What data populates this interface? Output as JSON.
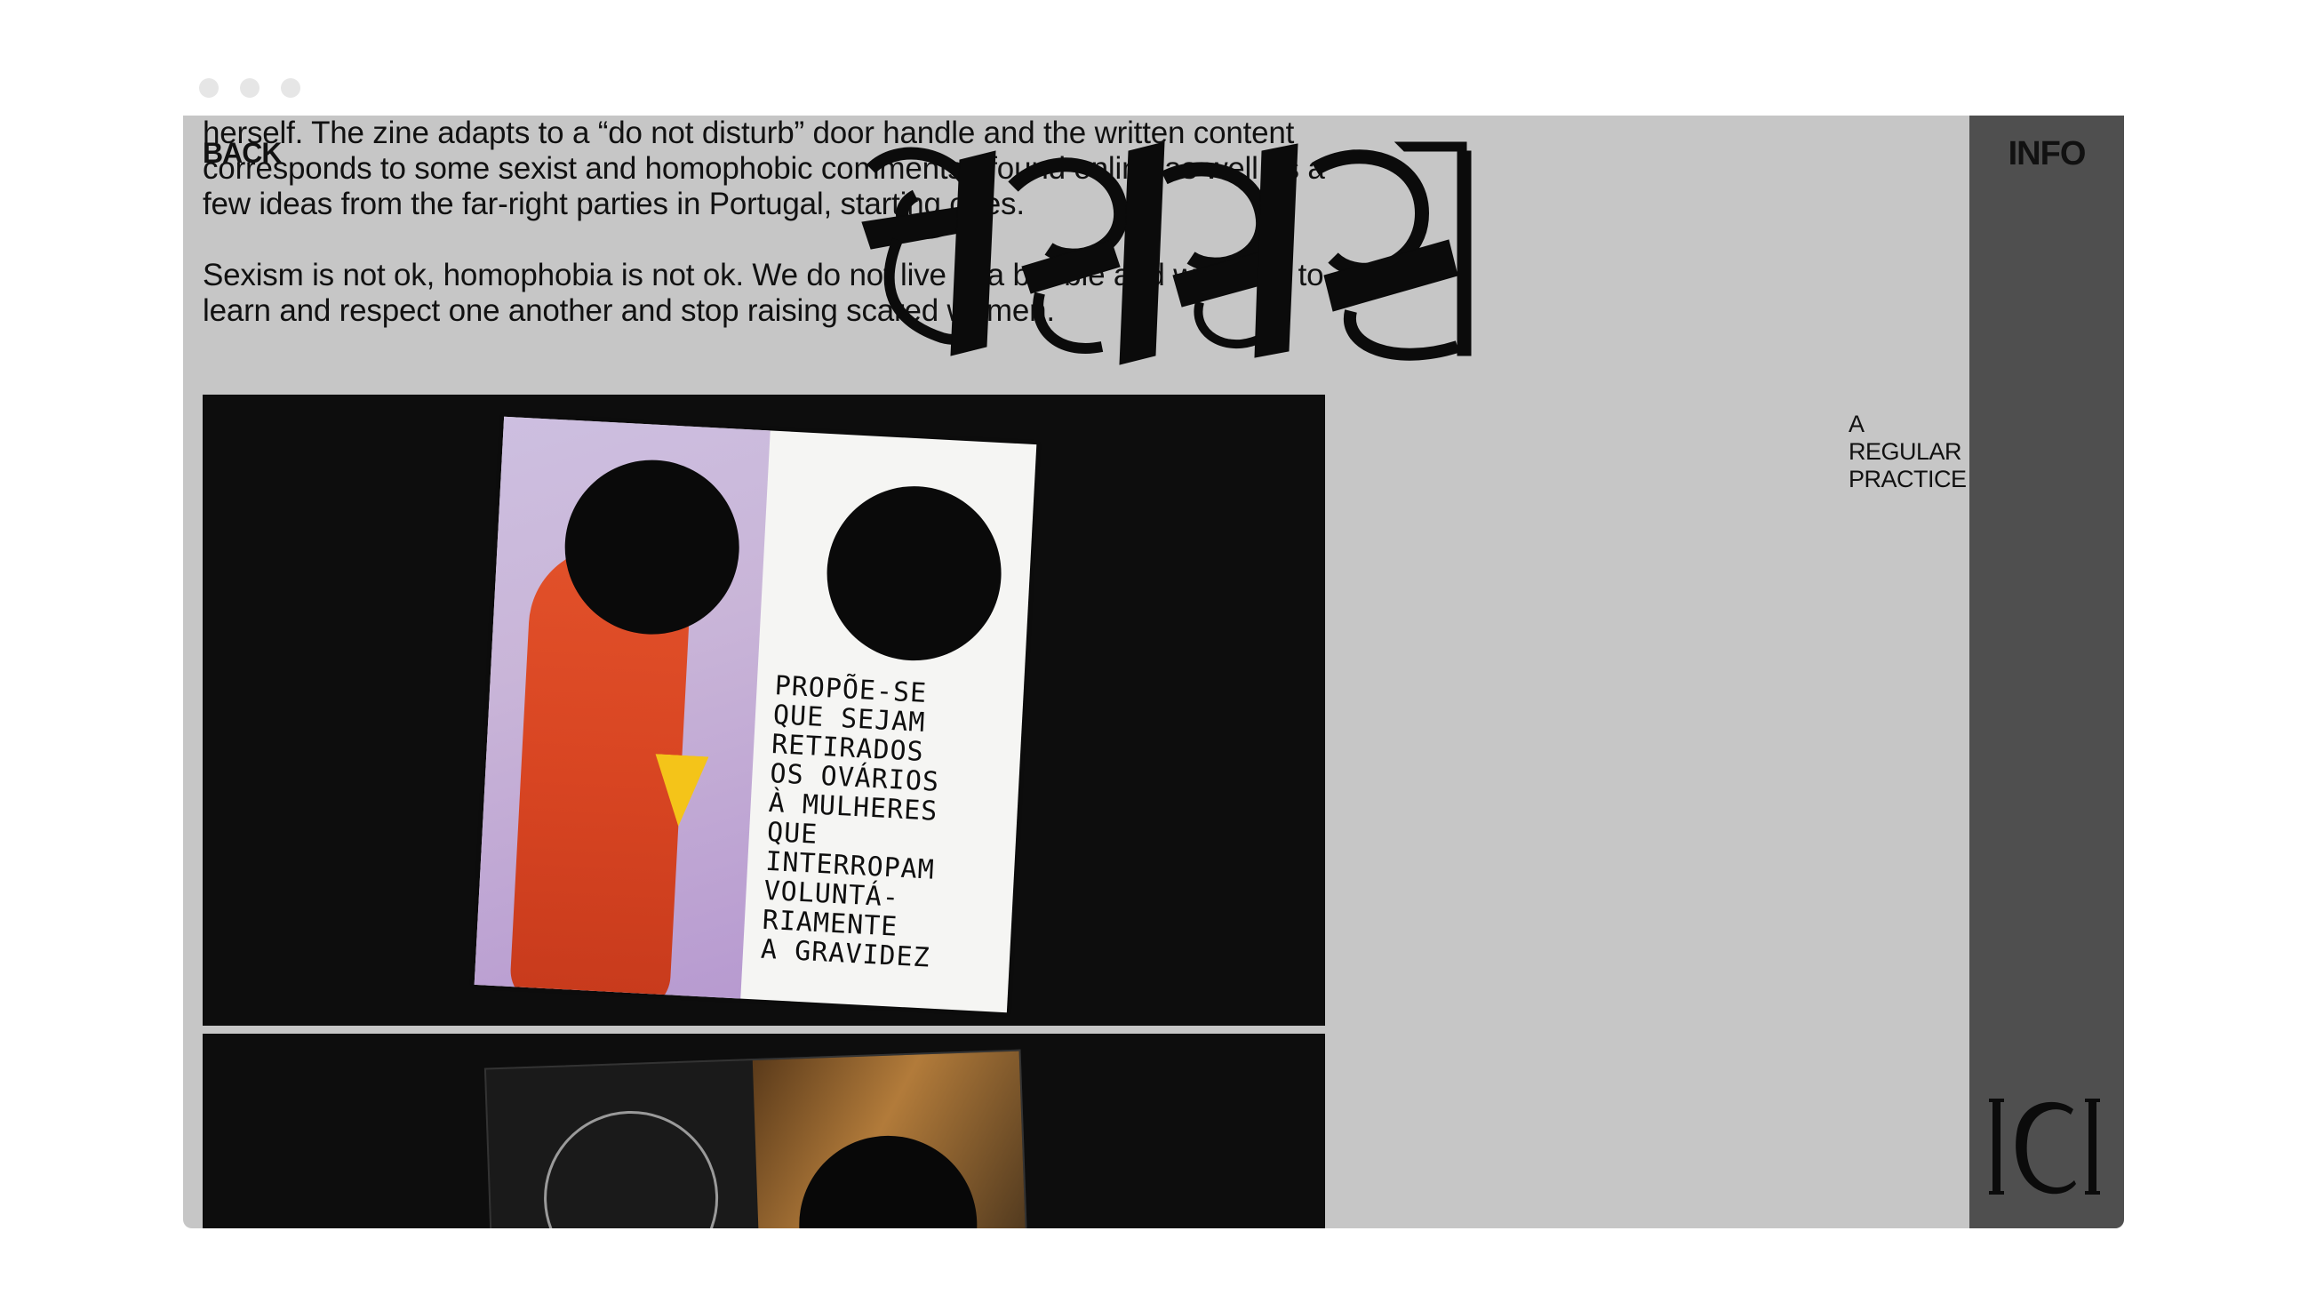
{
  "nav": {
    "back_label": "BACK",
    "info_label": "INFO"
  },
  "logo": {
    "tagline": "A REGULAR PRACTICE"
  },
  "article": {
    "paragraph1": "herself. The zine adapts to a “do not disturb” door handle and the written content corresponds to some sexist and homophobic comments I found online as well as a few ideas from the far-right parties in Portugal, starting ones.",
    "paragraph2": "Sexism is not ok, homophobia is not ok. We do not live in a bubble and we need to learn and respect one another and stop raising scared women."
  },
  "zine": {
    "text": "PROPÕE-SE\nQUE SEJAM\nRETIRADOS\nOS OVÁRIOS\nÀ MULHERES\nQUE\nINTERROPAM\nVOLUNTÁ-\nRIAMENTE\nA GRAVIDEZ"
  },
  "footer_logo": {
    "text": "ICI"
  },
  "colors": {
    "page_background": "#ffffff",
    "window_background": "#c6c6c6",
    "sidebar_background": "#4f4f4f",
    "image_panel_background": "#0d0d0d",
    "text": "#111111"
  }
}
